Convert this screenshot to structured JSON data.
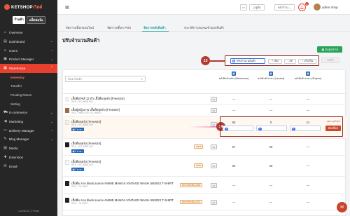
{
  "app": {
    "logo_text_main": "KETSHOP",
    "logo_text_accent": "เวิลด์",
    "mode_on": "ร้านค้า",
    "mode_off": "แพ็ตฟอร์ม",
    "version": "เวอร์ชัน 6.7.2+3444"
  },
  "sidebar": {
    "items": [
      {
        "label": "Overview",
        "icon": "home-icon"
      },
      {
        "label": "Dashboard",
        "icon": "chart-icon",
        "chevron": true
      },
      {
        "label": "Users",
        "icon": "users-icon",
        "chevron": true
      },
      {
        "label": "Product Manager",
        "icon": "box-icon",
        "chevron": true
      },
      {
        "label": "Warehouse",
        "icon": "warehouse-icon",
        "chevron": true,
        "active": true
      }
    ],
    "subitems": [
      {
        "label": "Inventory",
        "current": true
      },
      {
        "label": "Transfer"
      },
      {
        "label": "Pending Return"
      },
      {
        "label": "Setting"
      }
    ],
    "items_after": [
      {
        "label": "E-commerce",
        "icon": "cart-icon",
        "chevron": true
      },
      {
        "label": "Marketing",
        "icon": "megaphone-icon",
        "chevron": true
      },
      {
        "label": "Delivery Manager",
        "icon": "truck-icon",
        "chevron": true
      },
      {
        "label": "Blog Manager",
        "icon": "pen-icon",
        "chevron": true
      },
      {
        "label": "Media",
        "icon": "image-icon"
      },
      {
        "label": "Extension",
        "icon": "puzzle-icon"
      },
      {
        "label": "Email",
        "icon": "mail-icon"
      }
    ]
  },
  "header": {
    "grid_icon": "grid-icon",
    "btn_doc": "คู่มือ",
    "btn_shop": "หน้าร้าน",
    "notif_count": "1",
    "user_name": "admin shop"
  },
  "tabs": [
    {
      "label": "จัดการสต็อกออนไลน์"
    },
    {
      "label": "จัดการสต็อก POS"
    },
    {
      "label": "จัดการคลังสินค้า",
      "active": true
    },
    {
      "label": "ประวัติการสแกนเข้าออกสินค้า"
    }
  ],
  "page": {
    "title": "ปรับจำนวนสินค้า",
    "export_label": "Export All"
  },
  "mode": {
    "radio_label": "ปรับจำนวนสินค้า",
    "add_label": "+ เพิ่ม",
    "sub_label": "- ลด",
    "set_label": "= ปรับเป็น",
    "save_label": "บันทึก"
  },
  "callouts": {
    "a": "13",
    "b": "14"
  },
  "table": {
    "search_placeholder": "ค้นหาสินค้า",
    "columns": [
      {
        "label": "คลังสินค้าหลัก (Warehouse)"
      },
      {
        "label": "คลังสินค้าสาขา (Lazada)"
      },
      {
        "label": "คลังสินค้าสาขา (Shopee)"
      }
    ],
    "rows": [
      {
        "name": "เสื้อยืดไซส์ 12 ตัว เสื้อยืดสุดปัง [Freesize]",
        "sku": "SKU : SC-WBE-001",
        "values": [
          "—",
          "—",
          "—"
        ]
      },
      {
        "name": "เสื้อผู้หญิงลาย เสื้อยืดสุดปัง [Freesize]",
        "sku": "SKU : WBE-SET-SC-WBE1",
        "values": [
          "—",
          "—",
          "—"
        ]
      },
      {
        "name": "เสื้อยืดสุดปัง [Freesize]",
        "sku": "SKU : SC-WBE-003",
        "branch": "2 สาขา",
        "values": [
          "65",
          "0",
          "21"
        ],
        "highlight": true
      },
      {
        "name": "เสื้อยืดสุดปัง [Freesize]",
        "sku": "SKU : SC-WBE-001",
        "branch": "2 สาขา",
        "option": "black",
        "values": [
          "67",
          "28",
          "—"
        ]
      },
      {
        "name": "เสื้อยืดสุดปัง [Freesize]",
        "sku": "SKU : SC-WBE-002",
        "branch": "2 สาขา",
        "option": "white",
        "values": [
          "63",
          "25",
          "—"
        ]
      },
      {
        "name": "เสื้อยืด ลาย black source ANIME MANGA VINTAGE WASH UNISEX T-SHIRT",
        "sku": "SKU : 70-1003",
        "option": "Neon สีเหลือง-M25",
        "values": [
          "—",
          "—",
          "—"
        ]
      },
      {
        "name": "เสื้อยืด ลาย black source ANIME MANGA VINTAGE WASH UNISEX T-SHIRT",
        "sku": "SKU : 70-1004",
        "option": "Neon สีเหลือง-S24",
        "values": [
          "—",
          "—",
          "—"
        ]
      }
    ],
    "adjust_label": "จุดระบุตัวตน",
    "adjust_button": "ตัดสต็อก"
  }
}
